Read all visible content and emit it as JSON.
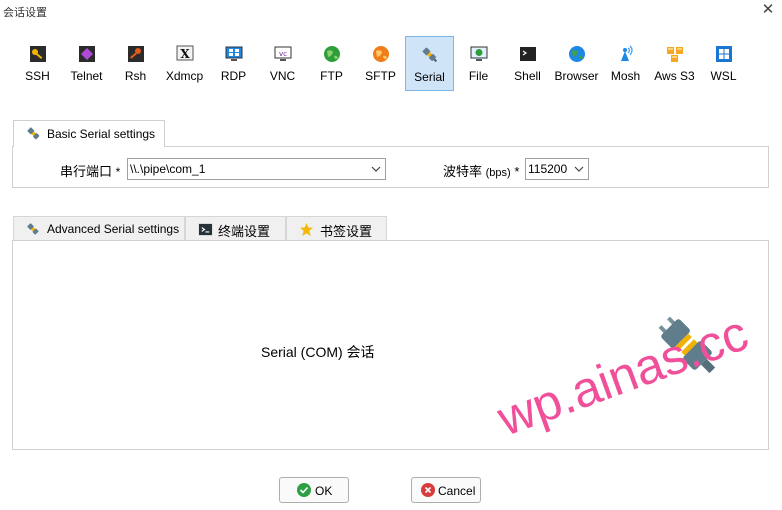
{
  "window": {
    "title": "会话设置",
    "close_glyph": "✕"
  },
  "protocols": [
    {
      "label": "SSH",
      "icon": "ssh-key-icon"
    },
    {
      "label": "Telnet",
      "icon": "telnet-icon"
    },
    {
      "label": "Rsh",
      "icon": "rsh-icon"
    },
    {
      "label": "Xdmcp",
      "icon": "xdmcp-icon"
    },
    {
      "label": "RDP",
      "icon": "rdp-monitor-icon"
    },
    {
      "label": "VNC",
      "icon": "vnc-monitor-icon"
    },
    {
      "label": "FTP",
      "icon": "ftp-globe-icon"
    },
    {
      "label": "SFTP",
      "icon": "sftp-globe-icon"
    },
    {
      "label": "Serial",
      "icon": "serial-plug-icon",
      "active": true
    },
    {
      "label": "File",
      "icon": "file-monitor-icon"
    },
    {
      "label": "Shell",
      "icon": "shell-terminal-icon"
    },
    {
      "label": "Browser",
      "icon": "browser-globe-icon"
    },
    {
      "label": "Mosh",
      "icon": "mosh-antenna-icon"
    },
    {
      "label": "Aws S3",
      "icon": "aws-s3-cubes-icon"
    },
    {
      "label": "WSL",
      "icon": "wsl-windows-icon"
    }
  ],
  "basic": {
    "tab_label": "Basic Serial settings",
    "port_label": "串行端口",
    "port_required": "*",
    "port_value": "\\\\.\\pipe\\com_1",
    "baud_label": "波特率",
    "baud_unit": "(bps)",
    "baud_required": "*",
    "baud_value": "115200"
  },
  "advanced_tabs": [
    {
      "label": "Advanced Serial settings",
      "icon": "serial-plug-icon"
    },
    {
      "label": "终端设置",
      "icon": "terminal-icon"
    },
    {
      "label": "书签设置",
      "icon": "star-icon"
    }
  ],
  "description": "Serial (COM) 会话",
  "watermark": "wp.ainas.cc",
  "buttons": {
    "ok": "OK",
    "cancel": "Cancel"
  },
  "colors": {
    "active_tab_bg": "#cfe4f7",
    "active_tab_border": "#7eb4ea",
    "ok_green": "#2ea043",
    "cancel_red": "#d83b3b"
  }
}
